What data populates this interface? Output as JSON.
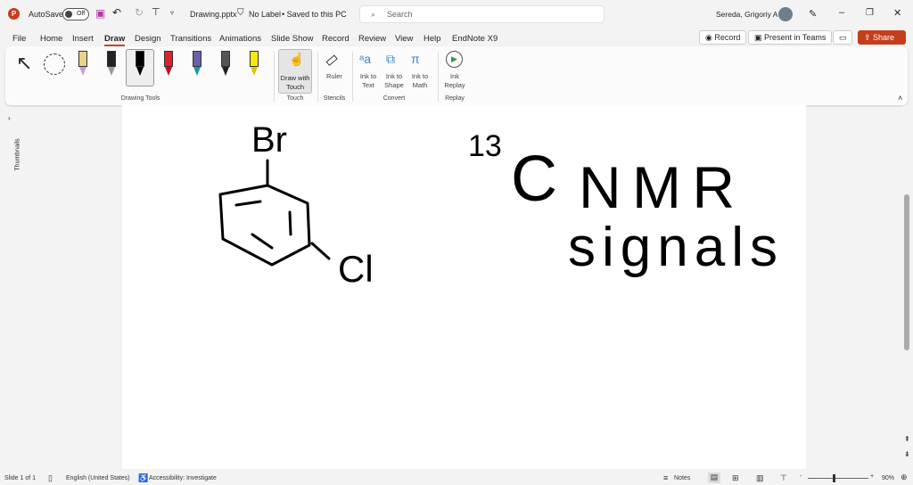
{
  "titlebar": {
    "app_icon": "P",
    "autosave": "AutoSave",
    "autosave_state": "Off",
    "filename": "Drawing.pptx",
    "label": "No Label",
    "saved": "• Saved to this PC",
    "search_placeholder": "Search",
    "user": "Sereda, Grigoriy A"
  },
  "tabs": [
    "File",
    "Home",
    "Insert",
    "Draw",
    "Design",
    "Transitions",
    "Animations",
    "Slide Show",
    "Record",
    "Review",
    "View",
    "Help",
    "EndNote X9"
  ],
  "active_tab": "Draw",
  "actions": {
    "record": "Record",
    "present": "Present in Teams",
    "share": "Share"
  },
  "ribbon": {
    "draw_touch": "Draw with Touch",
    "ruler": "Ruler",
    "ink_text": "Ink to Text",
    "ink_shape": "Ink to Shape",
    "ink_math": "Ink to Math",
    "ink_replay": "Ink Replay",
    "groups": {
      "drawing_tools": "Drawing Tools",
      "touch": "Touch",
      "stencils": "Stencils",
      "convert": "Convert",
      "replay": "Replay"
    }
  },
  "pens": [
    {
      "color": "#e8d38a",
      "tip": "#c8a0d8"
    },
    {
      "color": "#222222",
      "tip": "#999999"
    },
    {
      "color": "#000000",
      "tip": "#000000"
    },
    {
      "color": "#e0202a",
      "tip": "#c01020"
    },
    {
      "color": "#6a5fa8",
      "tip": "#1a9aa0"
    },
    {
      "color": "#555555",
      "tip": "#222222"
    },
    {
      "color": "#f6ea10",
      "tip": "#d8c800"
    }
  ],
  "thumbnails_label": "Thumbnails",
  "ink": {
    "br": "Br",
    "cl": "Cl",
    "isotope": "13",
    "c": "C",
    "nmr": "NMR",
    "signals": "signals"
  },
  "status": {
    "slide": "Slide 1 of 1",
    "language": "English (United States)",
    "accessibility": "Accessibility: Investigate",
    "notes": "Notes",
    "zoom": "90%"
  },
  "colors": {
    "accent": "#c43e1c"
  }
}
